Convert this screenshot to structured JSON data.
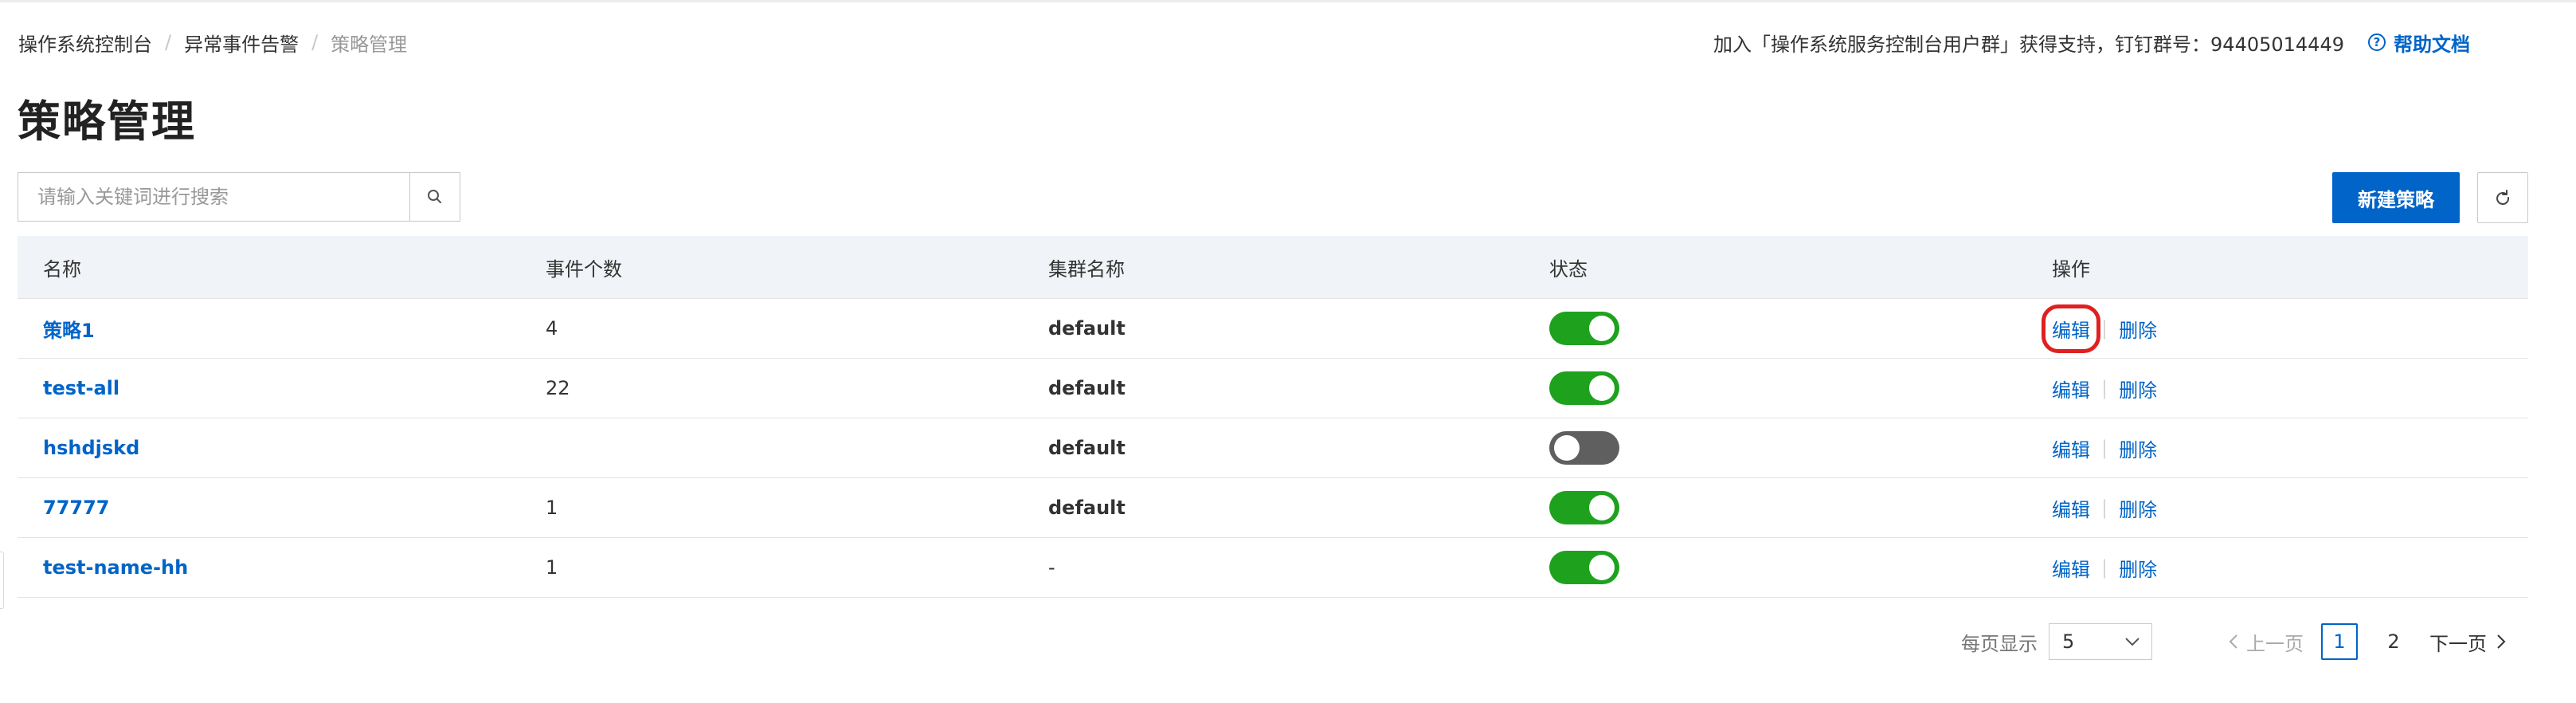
{
  "breadcrumb": [
    "操作系统控制台",
    "异常事件告警",
    "策略管理"
  ],
  "support": {
    "text": "加入「操作系统服务控制台用户群」获得支持，钉钉群号：94405014449",
    "help_label": "帮助文档",
    "help_icon": "?"
  },
  "page_title": "策略管理",
  "search": {
    "placeholder": "请输入关键词进行搜索",
    "value": ""
  },
  "toolbar": {
    "new_label": "新建策略"
  },
  "table": {
    "columns": [
      "名称",
      "事件个数",
      "集群名称",
      "状态",
      "操作"
    ],
    "rows": [
      {
        "name": "策略1",
        "count": "4",
        "cluster": "default",
        "enabled": true,
        "edit": "编辑",
        "delete": "删除"
      },
      {
        "name": "test-all",
        "count": "22",
        "cluster": "default",
        "enabled": true,
        "edit": "编辑",
        "delete": "删除"
      },
      {
        "name": "hshdjskd",
        "count": "",
        "cluster": "default",
        "enabled": false,
        "edit": "编辑",
        "delete": "删除"
      },
      {
        "name": "77777",
        "count": "1",
        "cluster": "default",
        "enabled": true,
        "edit": "编辑",
        "delete": "删除"
      },
      {
        "name": "test-name-hh",
        "count": "1",
        "cluster": "-",
        "enabled": true,
        "edit": "编辑",
        "delete": "删除"
      }
    ]
  },
  "pagination": {
    "per_page_label": "每页显示",
    "per_page_value": "5",
    "prev_label": "上一页",
    "pages": [
      "1",
      "2"
    ],
    "current_page": "1",
    "next_label": "下一页"
  },
  "colors": {
    "accent": "#0064c8",
    "toggle_on": "#1ea21e",
    "toggle_off": "#5f5f5f",
    "highlight": "#e02020"
  }
}
